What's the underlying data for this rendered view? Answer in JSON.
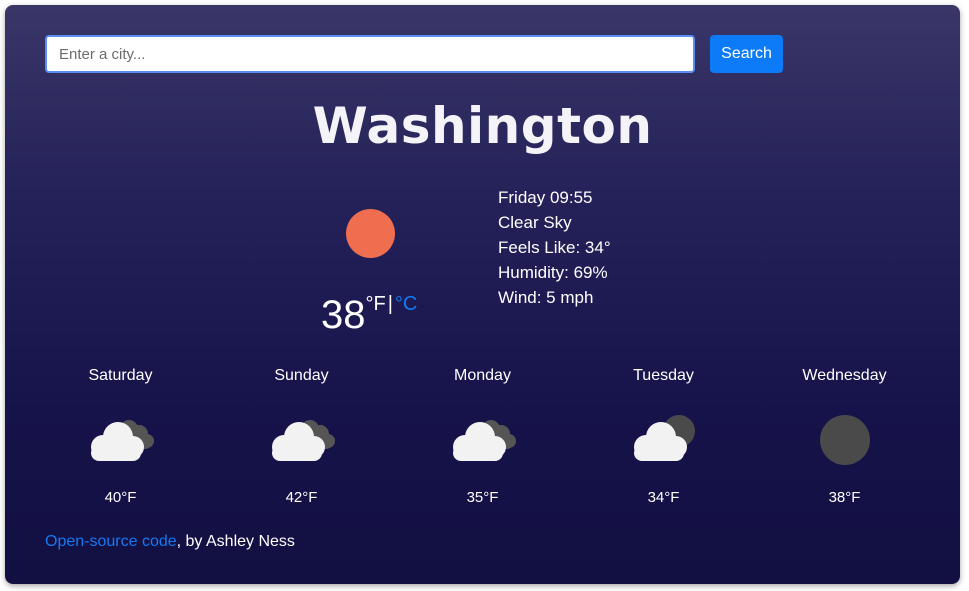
{
  "search": {
    "placeholder": "Enter a city...",
    "value": "",
    "button_label": "Search"
  },
  "current": {
    "city": "Washington",
    "icon": "sun-icon",
    "temperature": "38",
    "unit_fahrenheit": "°F",
    "unit_separator": "|",
    "unit_celsius": "°C",
    "datetime": "Friday 09:55",
    "description": "Clear Sky",
    "feels_like": "Feels Like: 34°",
    "humidity": "Humidity: 69%",
    "wind": "Wind: 5 mph"
  },
  "forecast": [
    {
      "day": "Saturday",
      "icon": "cloudy-icon",
      "temp": "40°F"
    },
    {
      "day": "Sunday",
      "icon": "cloudy-icon",
      "temp": "42°F"
    },
    {
      "day": "Monday",
      "icon": "cloudy-icon",
      "temp": "35°F"
    },
    {
      "day": "Tuesday",
      "icon": "partly-cloudy-night-icon",
      "temp": "34°F"
    },
    {
      "day": "Wednesday",
      "icon": "moon-icon",
      "temp": "38°F"
    }
  ],
  "footer": {
    "link_text": "Open-source code",
    "suffix": ", by Ashley Ness"
  },
  "colors": {
    "accent": "#0d7bf7",
    "link": "#1479f2",
    "sun": "#ee6e4f",
    "cloud_front": "#f2f2f2",
    "cloud_back": "#555555",
    "moon": "#4a4a4a"
  }
}
